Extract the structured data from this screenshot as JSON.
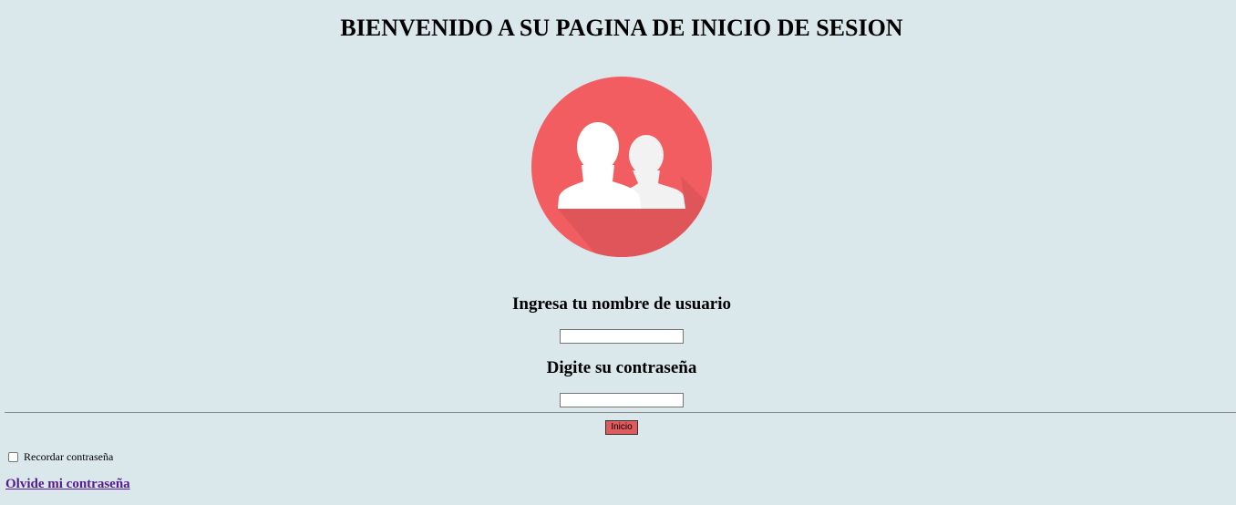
{
  "page": {
    "title": "BIENVENIDO A SU PAGINA DE INICIO DE SESION"
  },
  "avatar": {
    "icon": "users-group-icon",
    "circle_color": "#f25d61",
    "shadow_color": "#df5559",
    "figure_color": "#ffffff",
    "figure_back_color": "#f2f2f2"
  },
  "form": {
    "username_label": "Ingresa tu nombre de usuario",
    "username_value": "",
    "password_label": "Digite su contraseña",
    "password_value": "",
    "submit_label": "Inicio",
    "submit_color": "#e05a5e"
  },
  "remember": {
    "label": "Recordar contraseña",
    "checked": false
  },
  "links": {
    "forgot_password": "Olvide mi contraseña"
  },
  "colors": {
    "background": "#dae8ec",
    "link": "#551a8b"
  }
}
